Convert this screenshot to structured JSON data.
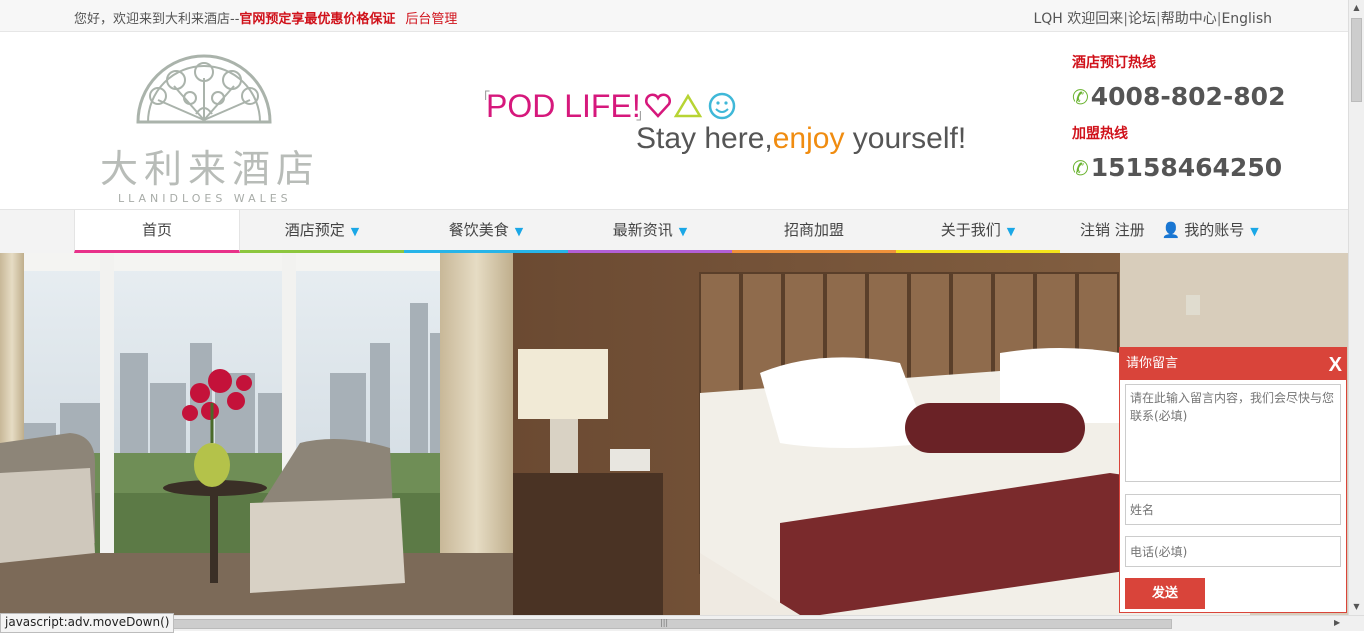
{
  "topbar": {
    "welcome": "您好，欢迎来到大利来酒店--",
    "promo": "官网预定享最优惠价格保证",
    "admin": "后台管理",
    "user": "LQH",
    "welcome_back": "欢迎回来",
    "sep": "|",
    "forum": "论坛",
    "help": "帮助中心",
    "english": "English"
  },
  "logo": {
    "cn": "大利来酒店",
    "en": "LLANIDLOES WALES"
  },
  "slogan": {
    "pod": "POD LIFE!",
    "stay_a": "Stay here,",
    "stay_b": "enjoy",
    "stay_c": " yourself!"
  },
  "hotline": {
    "booking_label": "酒店预订热线",
    "booking_number": "4008-802-802",
    "franchise_label": "加盟热线",
    "franchise_number": "15158464250",
    "phone_icon": "phone-icon"
  },
  "nav": {
    "items": [
      {
        "label": "首页",
        "dropdown": false,
        "color": "#e8318a"
      },
      {
        "label": "酒店预定",
        "dropdown": true,
        "color": "#8cc63e"
      },
      {
        "label": "餐饮美食",
        "dropdown": true,
        "color": "#27b4e8"
      },
      {
        "label": "最新资讯",
        "dropdown": true,
        "color": "#b25fd6"
      },
      {
        "label": "招商加盟",
        "dropdown": false,
        "color": "#f0913a"
      },
      {
        "label": "关于我们",
        "dropdown": true,
        "color": "#f4e41a"
      }
    ],
    "logout": "注销",
    "register": "注册",
    "account": "我的账号",
    "dropdown_glyph": "▼",
    "user_icon": "user-icon"
  },
  "message": {
    "title": "请你留言",
    "close": "X",
    "content_placeholder": "请在此输入留言内容，我们会尽快与您联系(必填)",
    "name_placeholder": "姓名",
    "phone_placeholder": "电话(必填)",
    "send": "发送"
  },
  "status": {
    "text": "javascript:adv.moveDown()"
  },
  "colors": {
    "accent_red": "#d0121b",
    "box_red": "#d9443a",
    "phone_green": "#6ab330"
  }
}
